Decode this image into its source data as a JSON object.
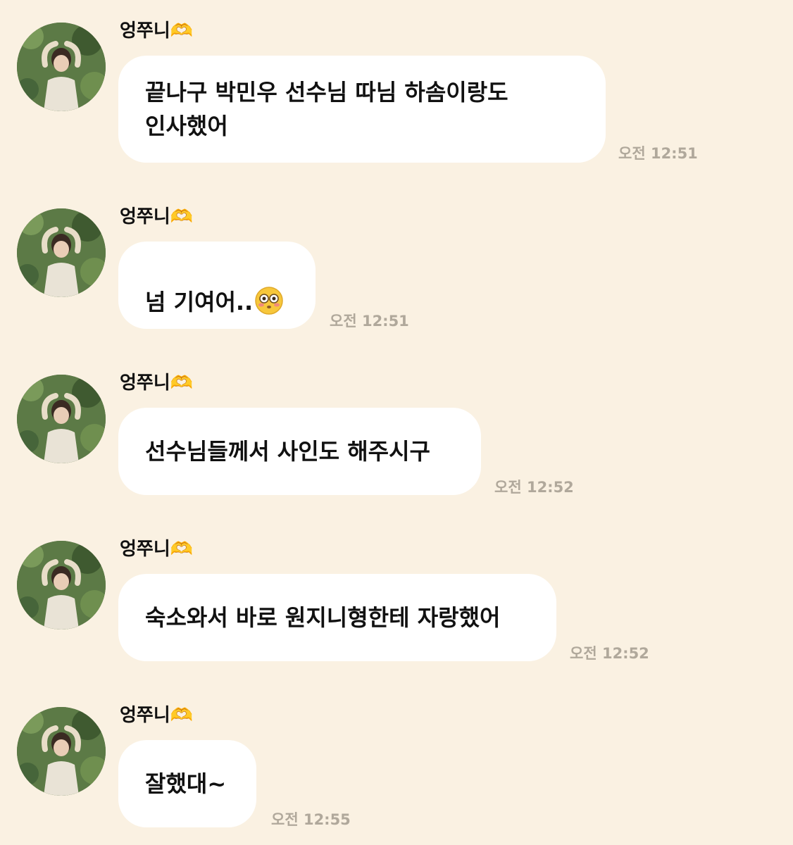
{
  "chat": {
    "messages": [
      {
        "sender": "엉쭈니🫶",
        "text": "끝나구 박민우 선수님 따님 하솜이랑도\n인사했어",
        "time": "오전 12:51"
      },
      {
        "sender": "엉쭈니🫶",
        "text": "넘 기여어..",
        "emoji": "flushed-face-emoji",
        "time": "오전 12:51"
      },
      {
        "sender": "엉쭈니🫶",
        "text": "선수님들께서 사인도 해주시구",
        "time": "오전 12:52"
      },
      {
        "sender": "엉쭈니🫶",
        "text": "숙소와서 바로 원지니형한테 자랑했어",
        "time": "오전 12:52"
      },
      {
        "sender": "엉쭈니🫶",
        "text": "잘했대~",
        "time": "오전 12:55"
      }
    ]
  },
  "colors": {
    "background": "#faf1e2",
    "bubble": "#ffffff",
    "timestamp": "#b0a89b"
  }
}
